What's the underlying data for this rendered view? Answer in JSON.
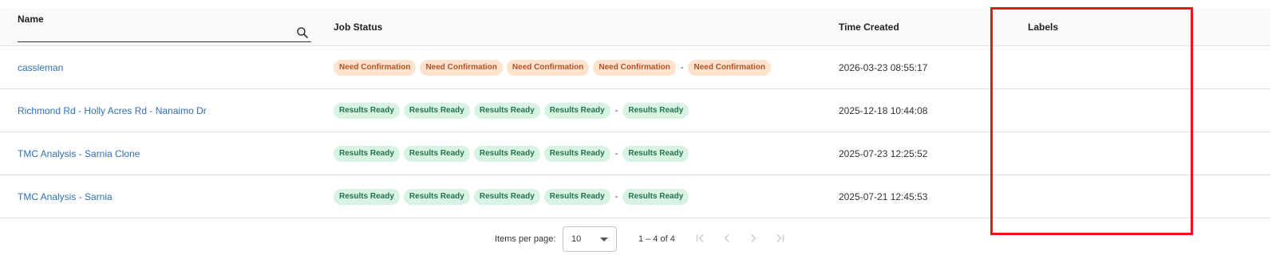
{
  "table": {
    "headers": {
      "name": "Name",
      "status": "Job Status",
      "time": "Time Created",
      "labels": "Labels"
    },
    "name_filter": {
      "value": "",
      "placeholder": ""
    },
    "rows": [
      {
        "name": "cassleman",
        "status_tone": "warn",
        "statuses": [
          "Need Confirmation",
          "Need Confirmation",
          "Need Confirmation",
          "Need Confirmation"
        ],
        "status_sep": "-",
        "status_last": "Need Confirmation",
        "time": "2026-03-23 08:55:17",
        "labels": ""
      },
      {
        "name": "Richmond Rd - Holly Acres Rd - Nanaimo Dr",
        "status_tone": "ok",
        "statuses": [
          "Results Ready",
          "Results Ready",
          "Results Ready",
          "Results Ready"
        ],
        "status_sep": "-",
        "status_last": "Results Ready",
        "time": "2025-12-18 10:44:08",
        "labels": ""
      },
      {
        "name": "TMC Analysis - Sarnia Clone",
        "status_tone": "ok",
        "statuses": [
          "Results Ready",
          "Results Ready",
          "Results Ready",
          "Results Ready"
        ],
        "status_sep": "-",
        "status_last": "Results Ready",
        "time": "2025-07-23 12:25:52",
        "labels": ""
      },
      {
        "name": "TMC Analysis - Sarnia",
        "status_tone": "ok",
        "statuses": [
          "Results Ready",
          "Results Ready",
          "Results Ready",
          "Results Ready"
        ],
        "status_sep": "-",
        "status_last": "Results Ready",
        "time": "2025-07-21 12:45:53",
        "labels": ""
      }
    ]
  },
  "paginator": {
    "items_per_page_label": "Items per page:",
    "page_size": "10",
    "range": "1 – 4 of 4"
  },
  "colors": {
    "link": "#2f6fb8",
    "warn_chip_bg": "#fde2cc",
    "warn_chip_text": "#b4532a",
    "ok_chip_bg": "#d8f3e3",
    "ok_chip_text": "#23744a",
    "highlight": "#e8151b"
  },
  "icons": {
    "search": "search-icon",
    "first_page": "first-page-icon",
    "prev_page": "chevron-left-icon",
    "next_page": "chevron-right-icon",
    "last_page": "last-page-icon"
  }
}
